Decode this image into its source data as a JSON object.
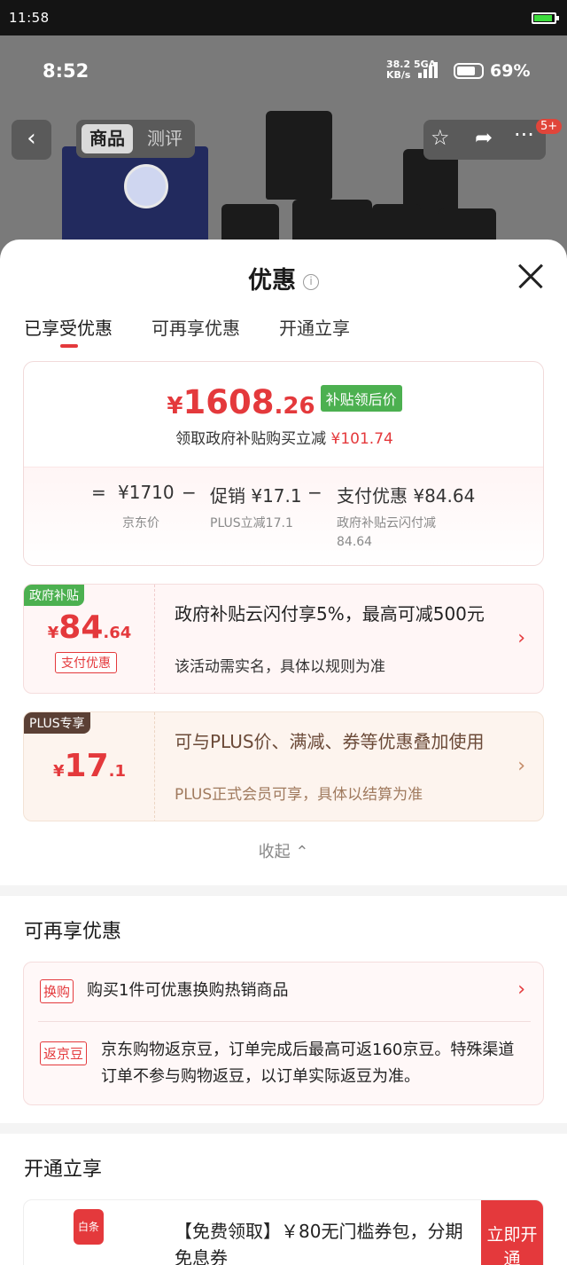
{
  "outer_status": {
    "time": "11:58"
  },
  "inner_status": {
    "time": "8:52",
    "net_speed": "38.2",
    "net_unit": "KB/s",
    "net_type": "5GA",
    "battery": "69%"
  },
  "top_nav": {
    "back_icon": "chevron-left-icon",
    "tabs": [
      "商品",
      "测评"
    ],
    "badge": "5+"
  },
  "sheet": {
    "title": "优惠",
    "subtabs": [
      "已享受优惠",
      "可再享优惠",
      "开通立享"
    ]
  },
  "summary": {
    "currency": "¥",
    "price_int": "1608",
    "price_dec": ".26",
    "price_tag": "补贴领后价",
    "desc": "领取政府补贴购买立减",
    "desc_amount": "¥101.74",
    "calc": {
      "eq": "=",
      "jd_price": "¥1710",
      "minus1": "−",
      "promo": "促销 ¥17.1",
      "minus2": "−",
      "pay": "支付优惠 ¥84.64"
    },
    "calc_sub": {
      "jd_label": "京东价",
      "plus_label": "PLUS立减17.1",
      "pay_label1": "政府补贴云闪付减",
      "pay_label2": "84.64"
    }
  },
  "coupon_gov": {
    "tag": "政府补贴",
    "currency": "¥",
    "amount_int": "84",
    "amount_dec": ".64",
    "chip": "支付优惠",
    "main": "政府补贴云闪付享5%，最高可减500元",
    "note": "该活动需实名，具体以规则为准"
  },
  "coupon_plus": {
    "tag": "PLUS专享",
    "currency": "¥",
    "amount_int": "17",
    "amount_dec": ".1",
    "main": "可与PLUS价、满减、券等优惠叠加使用",
    "note": "PLUS正式会员可享，具体以结算为准"
  },
  "collapse": "收起",
  "more": {
    "title": "可再享优惠",
    "rows": [
      {
        "tag": "换购",
        "text": "购买1件可优惠换购热销商品"
      },
      {
        "tag": "返京豆",
        "text": "京东购物返京豆，订单完成后最高可返160京豆。特殊渠道订单不参与购物返豆，以订单实际返豆为准。"
      }
    ]
  },
  "open": {
    "title": "开通立享",
    "icon_label": "白条",
    "text": "【免费领取】￥80无门槛券包，分期免息券",
    "button": "立即开通"
  },
  "colors": {
    "accent": "#e4393c",
    "green": "#4cb050",
    "plus_brown": "#5b4035"
  }
}
